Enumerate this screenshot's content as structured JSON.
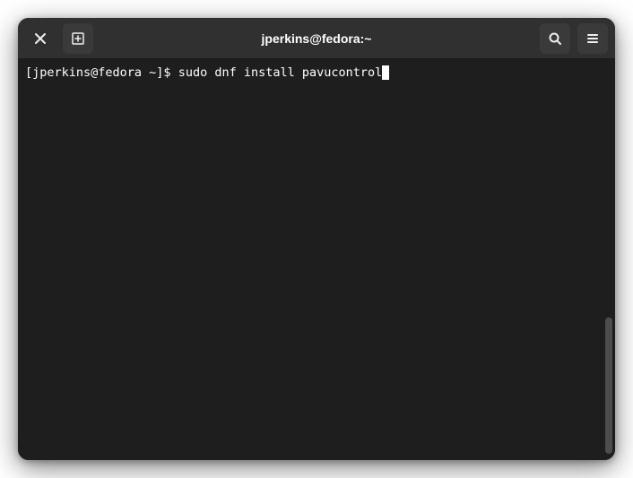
{
  "window": {
    "title": "jperkins@fedora:~"
  },
  "terminal": {
    "prompt": "[jperkins@fedora ~]$ ",
    "command": "sudo dnf install pavucontrol"
  },
  "icons": {
    "close": "close-icon",
    "newTab": "new-tab-icon",
    "search": "search-icon",
    "menu": "hamburger-menu-icon"
  }
}
